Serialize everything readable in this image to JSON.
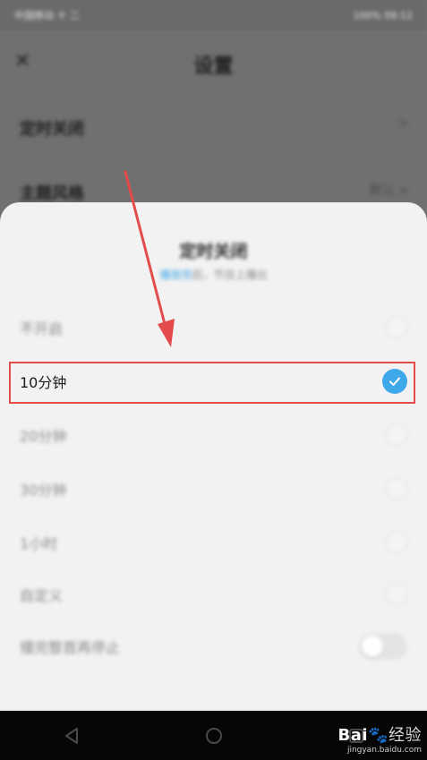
{
  "status_bar": {
    "left": "中国移动 十 二",
    "right": "100% 09:12"
  },
  "background_page": {
    "close_icon": "close-icon",
    "title": "设置",
    "rows": [
      {
        "label": "定时关闭",
        "value": ">"
      },
      {
        "label": "主题风格",
        "value": "默认 >"
      }
    ]
  },
  "sheet": {
    "title": "定时关闭",
    "subtitle_highlight": "播放完",
    "subtitle_rest": "后，节目上播出",
    "options": [
      {
        "label": "不开启",
        "selected": false
      },
      {
        "label": "10分钟",
        "selected": true
      },
      {
        "label": "20分钟",
        "selected": false
      },
      {
        "label": "30分钟",
        "selected": false
      },
      {
        "label": "1小时",
        "selected": false
      },
      {
        "label": "自定义",
        "selected": false
      }
    ],
    "toggle_row": {
      "label": "播完整首再停止",
      "enabled": false
    }
  },
  "nav_bar": {
    "icons": [
      "back-icon",
      "home-icon",
      "recents-icon"
    ]
  },
  "watermark": {
    "brand_prefix": "Bai",
    "brand_suffix": "经验",
    "url": "jingyan.baidu.com"
  },
  "colors": {
    "accent": "#3fa8e8",
    "highlight_border": "#e44b4b",
    "arrow": "#e44b4b"
  }
}
